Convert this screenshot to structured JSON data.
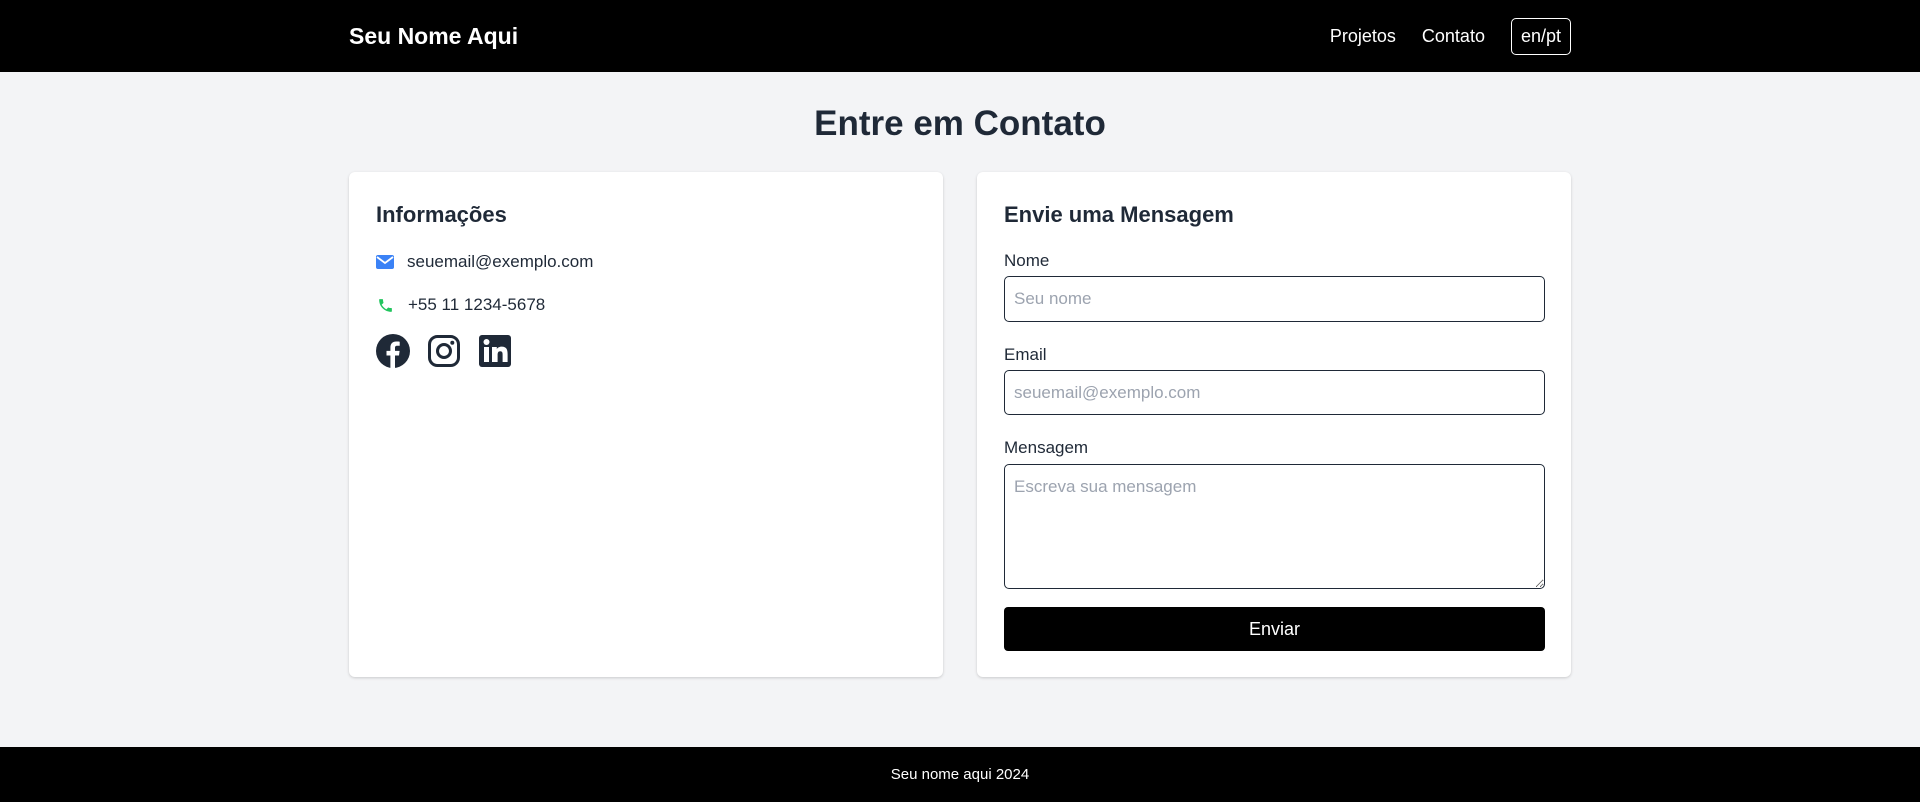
{
  "header": {
    "brand": "Seu Nome Aqui",
    "nav": [
      {
        "label": "Projetos"
      },
      {
        "label": "Contato"
      }
    ],
    "lang_toggle": "en/pt"
  },
  "page": {
    "title": "Entre em Contato"
  },
  "info": {
    "title": "Informações",
    "email": "seuemail@exemplo.com",
    "phone": "+55 11 1234-5678",
    "email_icon": "envelope-icon",
    "phone_icon": "phone-icon",
    "email_icon_color": "#3b82f6",
    "phone_icon_color": "#22c55e",
    "socials": [
      {
        "icon": "facebook-icon"
      },
      {
        "icon": "instagram-icon"
      },
      {
        "icon": "linkedin-icon"
      }
    ]
  },
  "form": {
    "title": "Envie uma Mensagem",
    "name_label": "Nome",
    "name_placeholder": "Seu nome",
    "email_label": "Email",
    "email_placeholder": "seuemail@exemplo.com",
    "message_label": "Mensagem",
    "message_placeholder": "Escreva sua mensagem",
    "submit_label": "Enviar"
  },
  "footer": {
    "text": "Seu nome aqui 2024"
  },
  "colors": {
    "header_bg": "#000000",
    "page_bg": "#f3f4f6",
    "card_bg": "#ffffff",
    "text": "#1f2937",
    "button_bg": "#000000"
  }
}
